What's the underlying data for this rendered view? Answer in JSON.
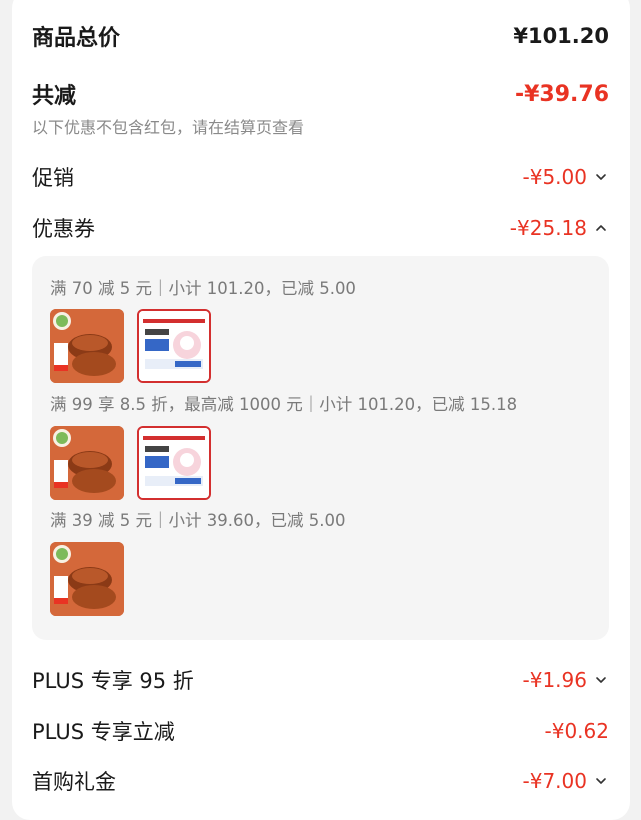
{
  "summary": {
    "total_label": "商品总价",
    "total_value": "¥101.20",
    "discount_label": "共减",
    "discount_value": "-¥39.76",
    "note": "以下优惠不包含红包，请在结算页查看"
  },
  "items": {
    "promo_label": "促销",
    "promo_value": "-¥5.00",
    "coupon_label": "优惠券",
    "coupon_value": "-¥25.18",
    "plus95_label": "PLUS 专享 95 折",
    "plus95_value": "-¥1.96",
    "plus_cut_label": "PLUS 专享立减",
    "plus_cut_value": "-¥0.62",
    "first_gift_label": "首购礼金",
    "first_gift_value": "-¥7.00"
  },
  "coupon_details": [
    {
      "text": "满 70 减 5 元｜小计 101.20，已减 5.00"
    },
    {
      "text": "满 99 享 8.5 折，最高减 1000 元｜小计 101.20，已减 15.18"
    },
    {
      "text": "满 39 减 5 元｜小计 39.60，已减 5.00"
    }
  ],
  "colors": {
    "accent": "#e93323",
    "text": "#1a1a1a",
    "muted": "#8a8a8a",
    "panel": "#f5f5f5"
  },
  "icons": [
    "chevron-down-icon",
    "chevron-up-icon"
  ]
}
